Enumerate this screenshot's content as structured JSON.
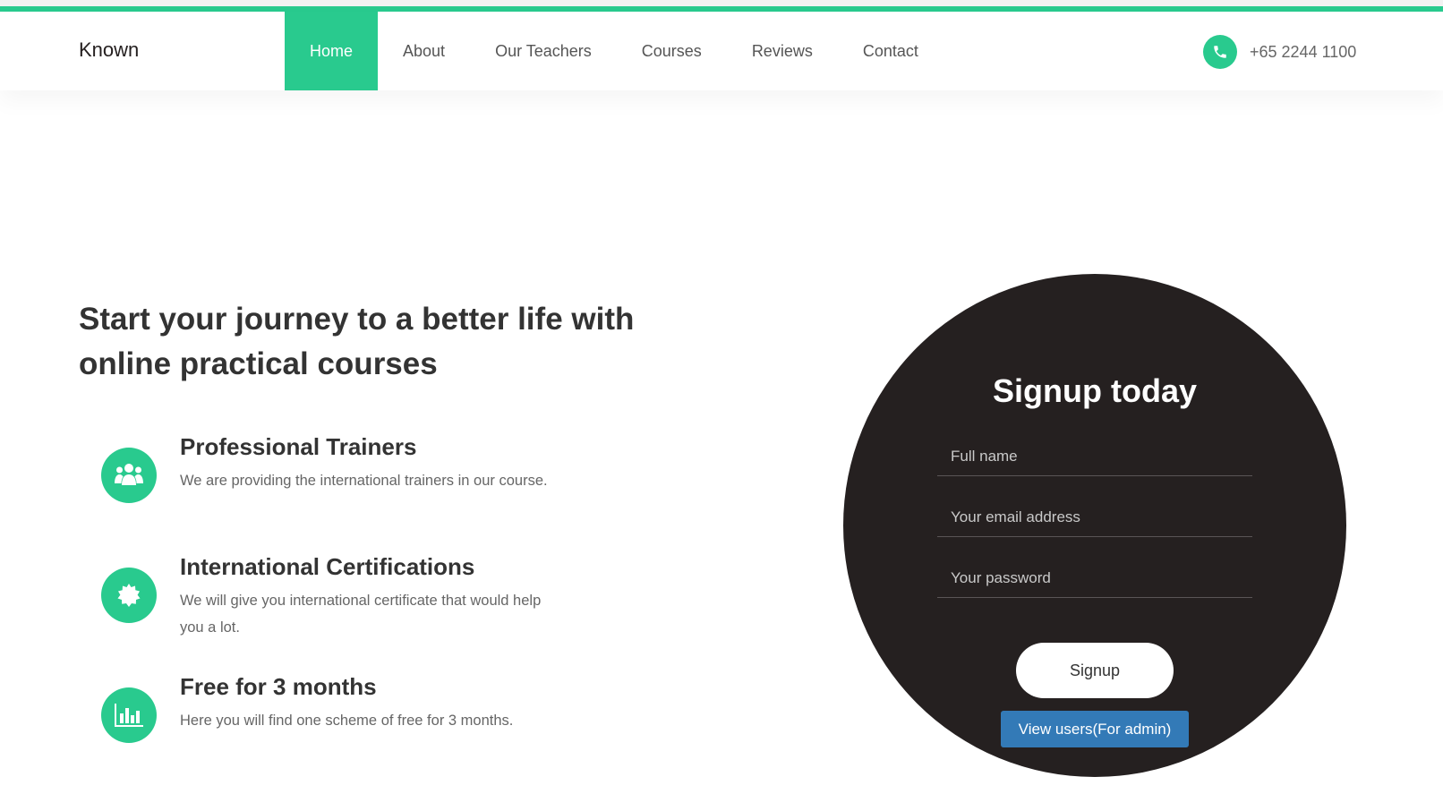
{
  "navbar": {
    "brand": "Known",
    "items": [
      {
        "label": "Home",
        "active": true
      },
      {
        "label": "About",
        "active": false
      },
      {
        "label": "Our Teachers",
        "active": false
      },
      {
        "label": "Courses",
        "active": false
      },
      {
        "label": "Reviews",
        "active": false
      },
      {
        "label": "Contact",
        "active": false
      }
    ],
    "phone": "+65 2244 1100",
    "phone_icon": "phone-icon"
  },
  "hero": {
    "title": "Start your journey to a better life with online practical courses"
  },
  "features": [
    {
      "icon": "users-icon",
      "title": "Professional Trainers",
      "desc": "We are providing the international trainers in our course."
    },
    {
      "icon": "certificate-icon",
      "title": "International Certifications",
      "desc": "We will give you international certificate that would help you a lot."
    },
    {
      "icon": "bar-chart-icon",
      "title": "Free for 3 months",
      "desc": "Here you will find one scheme of free for 3 months."
    }
  ],
  "signup": {
    "title": "Signup today",
    "fullname_placeholder": "Full name",
    "email_placeholder": "Your email address",
    "password_placeholder": "Your password",
    "signup_label": "Signup",
    "admin_label": "View users(For admin)"
  },
  "colors": {
    "accent": "#29ca8e",
    "dark": "#252020",
    "admin_button": "#337ab7"
  }
}
